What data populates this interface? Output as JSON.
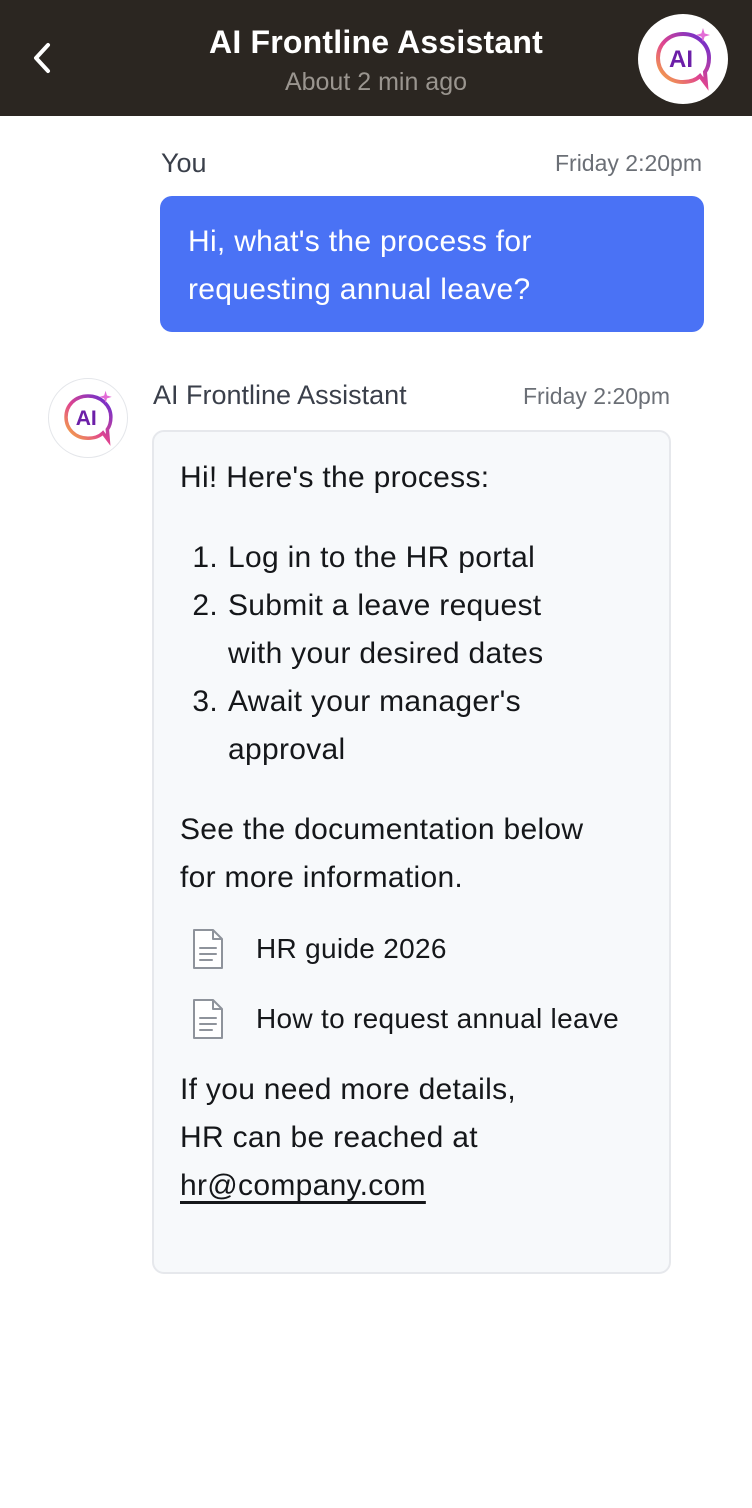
{
  "header": {
    "title": "AI Frontline Assistant",
    "subtitle": "About 2 min ago",
    "avatar_text": "AI"
  },
  "user_message": {
    "sender": "You",
    "time": "Friday 2:20pm",
    "lines": [
      "Hi, what's the process for",
      "requesting annual leave?"
    ]
  },
  "bot_message": {
    "sender": "AI Frontline Assistant",
    "time": "Friday 2:20pm",
    "avatar_text": "AI",
    "intro": "Hi! Here's the process:",
    "steps": [
      {
        "num": "1.",
        "lines": [
          "Log in to the HR portal"
        ]
      },
      {
        "num": "2.",
        "lines": [
          "Submit a leave request",
          "with your desired dates"
        ]
      },
      {
        "num": "3.",
        "lines": [
          "Await your manager's",
          "approval"
        ]
      }
    ],
    "see_more": [
      "See the documentation below",
      "for more information."
    ],
    "documents": [
      {
        "label": "HR guide 2026",
        "icon": "document-icon"
      },
      {
        "label": "How to request annual leave",
        "icon": "document-icon"
      }
    ],
    "outro": [
      "If you need more details,",
      "HR can be reached at"
    ],
    "email": "hr@company.com"
  },
  "colors": {
    "header_bg": "#2b2621",
    "user_bubble": "#4a72f5",
    "bot_bubble": "#f7f9fb",
    "logo_gradient_start": "#f2a23a",
    "logo_gradient_end": "#7a2fd6"
  }
}
